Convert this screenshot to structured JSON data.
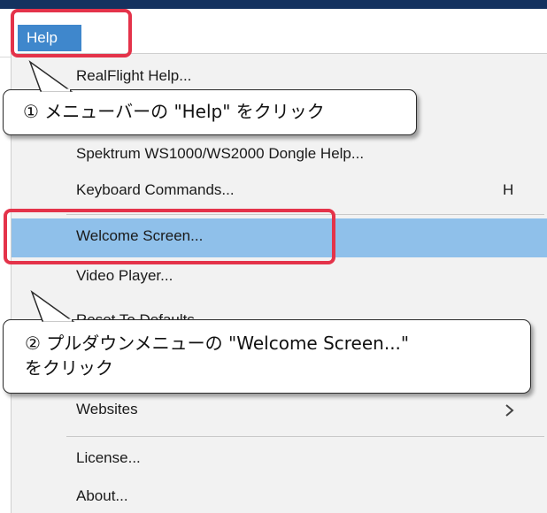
{
  "menubar": {
    "help_label": "Help"
  },
  "menu": {
    "items": [
      {
        "label": "RealFlight Help...",
        "shortcut": ""
      },
      {
        "label": "Spektrum WS1000/WS2000 Dongle Help...",
        "shortcut": ""
      },
      {
        "label": "Keyboard Commands...",
        "shortcut": "H"
      },
      {
        "label": "Welcome Screen...",
        "shortcut": "",
        "state": "highlighted"
      },
      {
        "label": "Video Player...",
        "shortcut": ""
      },
      {
        "label": "Reset To Defaults",
        "shortcut": ""
      },
      {
        "label": "Websites",
        "shortcut": "",
        "submenu": true
      },
      {
        "label": "License...",
        "shortcut": ""
      },
      {
        "label": "About...",
        "shortcut": ""
      }
    ]
  },
  "callouts": {
    "step1": "① メニューバーの \"Help\" をクリック",
    "step2": "② プルダウンメニューの \"Welcome Screen...\"\nをクリック"
  },
  "icons": {
    "submenu_arrow": "chevron-right-icon"
  },
  "colors": {
    "title_strip": "#14325f",
    "menu_active": "#3f87cc",
    "item_highlight": "#8fc0ea",
    "annotation_red": "#e4334a"
  }
}
